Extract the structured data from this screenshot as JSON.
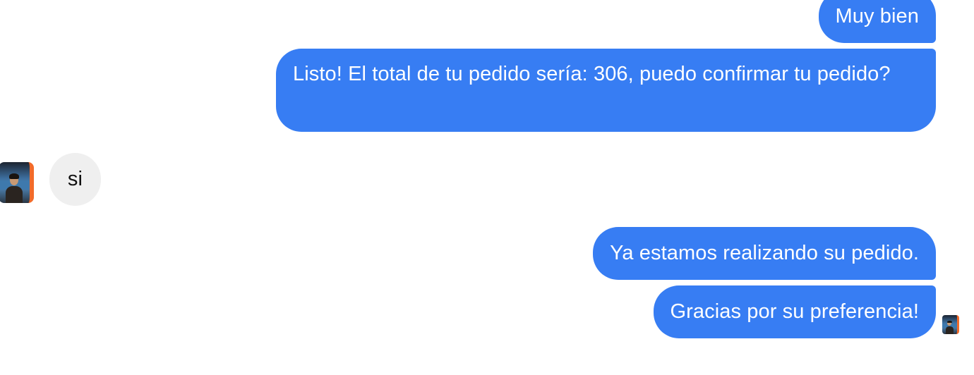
{
  "colors": {
    "outgoing_bubble": "#377df3",
    "incoming_bubble": "#efefef",
    "outgoing_text": "#ffffff",
    "incoming_text": "#111111",
    "avatar_accent": "#f26b2a"
  },
  "messages": [
    {
      "direction": "outgoing",
      "text": "Muy bien"
    },
    {
      "direction": "outgoing",
      "text": "Listo! El total de tu pedido sería: 306, puedo confirmar tu pedido?"
    },
    {
      "direction": "incoming",
      "text": "si"
    },
    {
      "direction": "outgoing",
      "text": "Ya estamos realizando su pedido."
    },
    {
      "direction": "outgoing",
      "text": "Gracias por su preferencia!"
    }
  ],
  "avatars": {
    "contact": "user-avatar-photo",
    "read_receipt": "read-receipt-avatar-photo"
  }
}
